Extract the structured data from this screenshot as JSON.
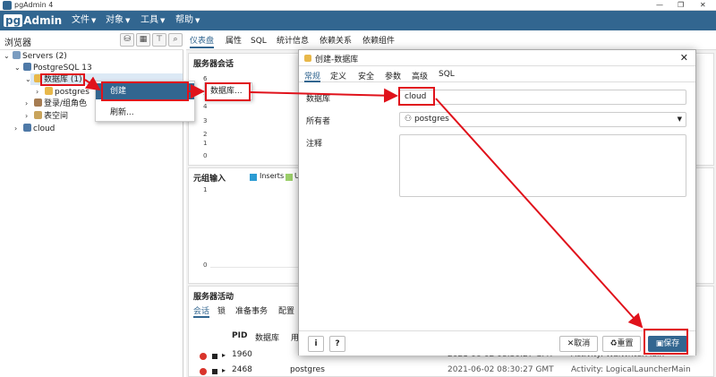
{
  "window": {
    "title": "pgAdmin 4",
    "controls": [
      "—",
      "❐",
      "✕"
    ]
  },
  "menubar": {
    "logo_pg": "pg",
    "logo_rest": "Admin",
    "items": [
      "文件",
      "对象",
      "工具",
      "帮助"
    ]
  },
  "browser": {
    "label": "浏览器"
  },
  "tree": {
    "servers": "Servers (2)",
    "pg13": "PostgreSQL 13",
    "databases": "数据库 (1)",
    "postgres": "postgres",
    "roles": "登录/组角色",
    "tablespaces": "表空间",
    "cloud": "cloud"
  },
  "context_menu": {
    "create": "创建",
    "refresh": "刷新...",
    "submenu_database": "数据库..."
  },
  "main_tabs": [
    "仪表盘",
    "属性",
    "SQL",
    "统计信息",
    "依赖关系",
    "依赖组件"
  ],
  "dashboard": {
    "sessions_title": "服务器会话",
    "sessions_ticks": [
      "6",
      "5",
      "4",
      "3",
      "2",
      "1",
      "0"
    ],
    "tuples_in_title": "元组输入",
    "tuples_in_legend": [
      "Inserts",
      "Up"
    ],
    "tuples_in_ticks": [
      "1",
      "0"
    ],
    "activity_title": "服务器活动",
    "activity_tabs": [
      "会话",
      "锁",
      "准备事务",
      "配置"
    ],
    "activity_headers": [
      "PID",
      "数据库",
      "用"
    ],
    "activity_rows": [
      {
        "pid": "1960",
        "db": "",
        "time": "2021-06-02 08:30:27 GMT",
        "activity": "Activity: WalWriterMain"
      },
      {
        "pid": "2468",
        "db": "postgres",
        "time": "2021-06-02 08:30:27 GMT",
        "activity": "Activity: LogicalLauncherMain"
      }
    ]
  },
  "dialog": {
    "title": "创建-数据库",
    "tabs": [
      "常规",
      "定义",
      "安全",
      "参数",
      "高级",
      "SQL"
    ],
    "database_label": "数据库",
    "database_value": "cloud",
    "owner_label": "所有者",
    "owner_value": "postgres",
    "comment_label": "注释",
    "cancel": "取消",
    "reset": "重置",
    "save": "保存",
    "info": "i",
    "help": "?"
  },
  "colors": {
    "brand": "#326690",
    "annotation_red": "#e0121b",
    "selected_row": "#dce9f5"
  }
}
